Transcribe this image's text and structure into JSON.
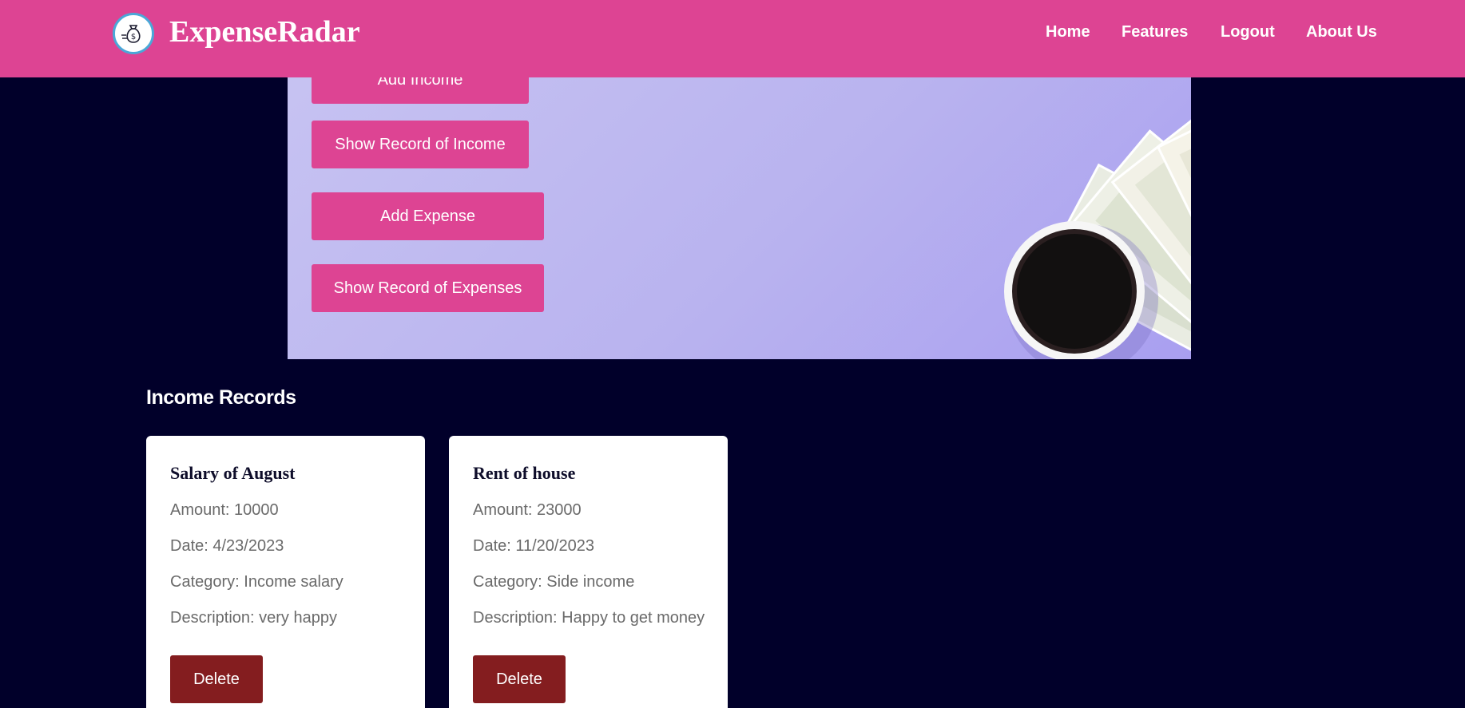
{
  "navbar": {
    "brand": "ExpenseRadar",
    "links": [
      "Home",
      "Features",
      "Logout",
      "About Us"
    ]
  },
  "hero": {
    "buttons": {
      "add_income": "Add Income",
      "show_income": "Show Record of Income",
      "add_expense": "Add Expense",
      "show_expenses": "Show Record of Expenses"
    }
  },
  "income": {
    "title": "Income Records",
    "records": [
      {
        "title": "Salary of August",
        "amount": "Amount: 10000",
        "date": "Date: 4/23/2023",
        "category": "Category: Income salary",
        "description": "Description: very happy",
        "delete_label": "Delete"
      },
      {
        "title": "Rent of house",
        "amount": "Amount: 23000",
        "date": "Date: 11/20/2023",
        "category": "Category: Side income",
        "description": "Description: Happy to get money",
        "delete_label": "Delete"
      }
    ]
  },
  "colors": {
    "brand_pink": "#dd4493",
    "page_bg": "#01002a",
    "delete_red": "#841d1f",
    "hero_lavender": "#c7c3f2"
  },
  "icons": {
    "logo": "money-bag-icon"
  }
}
